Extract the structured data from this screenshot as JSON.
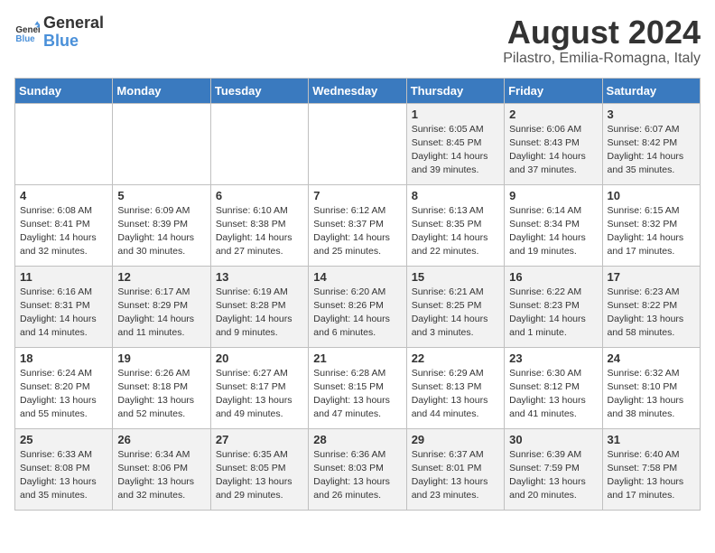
{
  "logo": {
    "general": "General",
    "blue": "Blue"
  },
  "title": "August 2024",
  "subtitle": "Pilastro, Emilia-Romagna, Italy",
  "days_header": [
    "Sunday",
    "Monday",
    "Tuesday",
    "Wednesday",
    "Thursday",
    "Friday",
    "Saturday"
  ],
  "weeks": [
    [
      {
        "day": "",
        "info": ""
      },
      {
        "day": "",
        "info": ""
      },
      {
        "day": "",
        "info": ""
      },
      {
        "day": "",
        "info": ""
      },
      {
        "day": "1",
        "info": "Sunrise: 6:05 AM\nSunset: 8:45 PM\nDaylight: 14 hours\nand 39 minutes."
      },
      {
        "day": "2",
        "info": "Sunrise: 6:06 AM\nSunset: 8:43 PM\nDaylight: 14 hours\nand 37 minutes."
      },
      {
        "day": "3",
        "info": "Sunrise: 6:07 AM\nSunset: 8:42 PM\nDaylight: 14 hours\nand 35 minutes."
      }
    ],
    [
      {
        "day": "4",
        "info": "Sunrise: 6:08 AM\nSunset: 8:41 PM\nDaylight: 14 hours\nand 32 minutes."
      },
      {
        "day": "5",
        "info": "Sunrise: 6:09 AM\nSunset: 8:39 PM\nDaylight: 14 hours\nand 30 minutes."
      },
      {
        "day": "6",
        "info": "Sunrise: 6:10 AM\nSunset: 8:38 PM\nDaylight: 14 hours\nand 27 minutes."
      },
      {
        "day": "7",
        "info": "Sunrise: 6:12 AM\nSunset: 8:37 PM\nDaylight: 14 hours\nand 25 minutes."
      },
      {
        "day": "8",
        "info": "Sunrise: 6:13 AM\nSunset: 8:35 PM\nDaylight: 14 hours\nand 22 minutes."
      },
      {
        "day": "9",
        "info": "Sunrise: 6:14 AM\nSunset: 8:34 PM\nDaylight: 14 hours\nand 19 minutes."
      },
      {
        "day": "10",
        "info": "Sunrise: 6:15 AM\nSunset: 8:32 PM\nDaylight: 14 hours\nand 17 minutes."
      }
    ],
    [
      {
        "day": "11",
        "info": "Sunrise: 6:16 AM\nSunset: 8:31 PM\nDaylight: 14 hours\nand 14 minutes."
      },
      {
        "day": "12",
        "info": "Sunrise: 6:17 AM\nSunset: 8:29 PM\nDaylight: 14 hours\nand 11 minutes."
      },
      {
        "day": "13",
        "info": "Sunrise: 6:19 AM\nSunset: 8:28 PM\nDaylight: 14 hours\nand 9 minutes."
      },
      {
        "day": "14",
        "info": "Sunrise: 6:20 AM\nSunset: 8:26 PM\nDaylight: 14 hours\nand 6 minutes."
      },
      {
        "day": "15",
        "info": "Sunrise: 6:21 AM\nSunset: 8:25 PM\nDaylight: 14 hours\nand 3 minutes."
      },
      {
        "day": "16",
        "info": "Sunrise: 6:22 AM\nSunset: 8:23 PM\nDaylight: 14 hours\nand 1 minute."
      },
      {
        "day": "17",
        "info": "Sunrise: 6:23 AM\nSunset: 8:22 PM\nDaylight: 13 hours\nand 58 minutes."
      }
    ],
    [
      {
        "day": "18",
        "info": "Sunrise: 6:24 AM\nSunset: 8:20 PM\nDaylight: 13 hours\nand 55 minutes."
      },
      {
        "day": "19",
        "info": "Sunrise: 6:26 AM\nSunset: 8:18 PM\nDaylight: 13 hours\nand 52 minutes."
      },
      {
        "day": "20",
        "info": "Sunrise: 6:27 AM\nSunset: 8:17 PM\nDaylight: 13 hours\nand 49 minutes."
      },
      {
        "day": "21",
        "info": "Sunrise: 6:28 AM\nSunset: 8:15 PM\nDaylight: 13 hours\nand 47 minutes."
      },
      {
        "day": "22",
        "info": "Sunrise: 6:29 AM\nSunset: 8:13 PM\nDaylight: 13 hours\nand 44 minutes."
      },
      {
        "day": "23",
        "info": "Sunrise: 6:30 AM\nSunset: 8:12 PM\nDaylight: 13 hours\nand 41 minutes."
      },
      {
        "day": "24",
        "info": "Sunrise: 6:32 AM\nSunset: 8:10 PM\nDaylight: 13 hours\nand 38 minutes."
      }
    ],
    [
      {
        "day": "25",
        "info": "Sunrise: 6:33 AM\nSunset: 8:08 PM\nDaylight: 13 hours\nand 35 minutes."
      },
      {
        "day": "26",
        "info": "Sunrise: 6:34 AM\nSunset: 8:06 PM\nDaylight: 13 hours\nand 32 minutes."
      },
      {
        "day": "27",
        "info": "Sunrise: 6:35 AM\nSunset: 8:05 PM\nDaylight: 13 hours\nand 29 minutes."
      },
      {
        "day": "28",
        "info": "Sunrise: 6:36 AM\nSunset: 8:03 PM\nDaylight: 13 hours\nand 26 minutes."
      },
      {
        "day": "29",
        "info": "Sunrise: 6:37 AM\nSunset: 8:01 PM\nDaylight: 13 hours\nand 23 minutes."
      },
      {
        "day": "30",
        "info": "Sunrise: 6:39 AM\nSunset: 7:59 PM\nDaylight: 13 hours\nand 20 minutes."
      },
      {
        "day": "31",
        "info": "Sunrise: 6:40 AM\nSunset: 7:58 PM\nDaylight: 13 hours\nand 17 minutes."
      }
    ]
  ]
}
